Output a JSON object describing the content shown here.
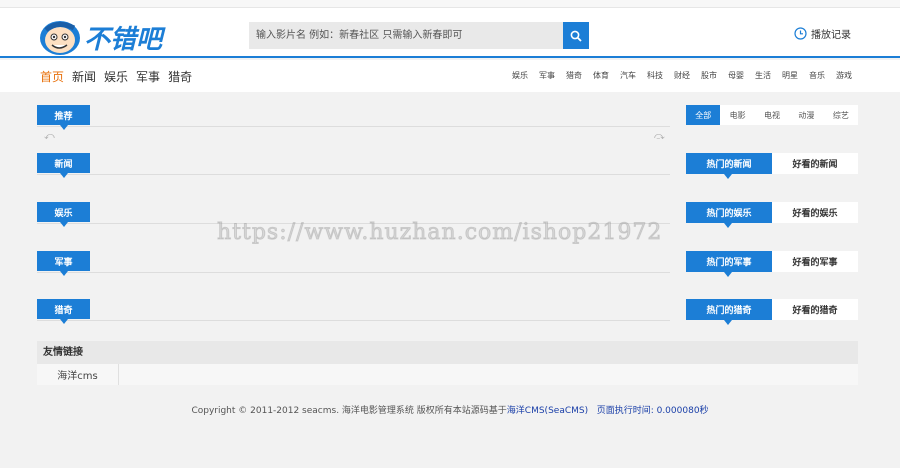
{
  "search": {
    "placeholder": "输入影片名 例如：新春社区 只需输入新春即可"
  },
  "history": {
    "label": "播放记录"
  },
  "main_nav": [
    "首页",
    "新闻",
    "娱乐",
    "军事",
    "猎奇"
  ],
  "sub_nav": [
    "娱乐",
    "军事",
    "猎奇",
    "体育",
    "汽车",
    "科技",
    "财经",
    "股市",
    "母婴",
    "生活",
    "明星",
    "音乐",
    "游戏"
  ],
  "sections": {
    "recommend": "推荐",
    "news": "新闻",
    "ent": "娱乐",
    "military": "军事",
    "curious": "猎奇"
  },
  "filter_tabs": [
    "全部",
    "电影",
    "电视",
    "动漫",
    "综艺"
  ],
  "rank": {
    "news": {
      "hot": "热门的新闻",
      "good": "好看的新闻"
    },
    "ent": {
      "hot": "热门的娱乐",
      "good": "好看的娱乐"
    },
    "military": {
      "hot": "热门的军事",
      "good": "好看的军事"
    },
    "curious": {
      "hot": "热门的猎奇",
      "good": "好看的猎奇"
    }
  },
  "links": {
    "title": "友情链接",
    "items": [
      "海洋cms"
    ]
  },
  "footer": {
    "copyright": "Copyright © 2011-2012 seacms. 海洋电影管理系统 版权所有本站源码基于",
    "powered": "海洋CMS(SeaCMS)",
    "exec": "页面执行时间: 0.000080秒"
  },
  "watermark": "https://www.huzhan.com/ishop21972",
  "colors": {
    "accent": "#1c7ed6",
    "active_nav": "#e8700b"
  },
  "icons": {
    "search": "search-icon",
    "history": "clock-icon",
    "logo": "smiley-logo"
  }
}
